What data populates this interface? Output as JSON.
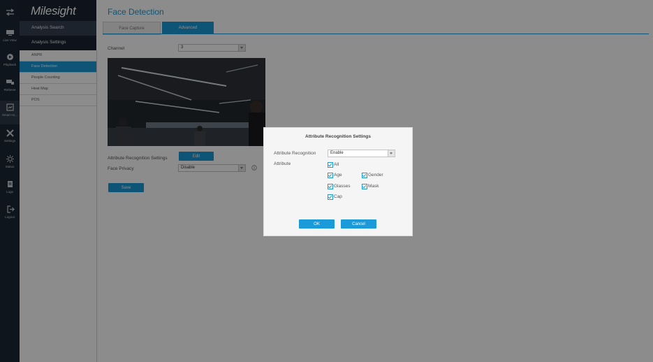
{
  "app": {
    "brand": "Milesight"
  },
  "rail": [
    {
      "label": "",
      "icon": "swap-arrows-icon"
    },
    {
      "label": "Live View",
      "icon": "monitor-icon"
    },
    {
      "label": "Playback",
      "icon": "playback-icon"
    },
    {
      "label": "Retrieve",
      "icon": "retrieve-icon"
    },
    {
      "label": "Smart An...",
      "icon": "smart-analysis-icon"
    },
    {
      "label": "Settings",
      "icon": "tools-icon"
    },
    {
      "label": "Status",
      "icon": "status-icon"
    },
    {
      "label": "Logs",
      "icon": "logs-icon"
    },
    {
      "label": "Logout",
      "icon": "logout-icon"
    }
  ],
  "sidebar": {
    "analysis_search": "Analysis Search",
    "analysis_settings": "Analysis Settings",
    "items": [
      "ANPR",
      "Face Detection",
      "People Counting",
      "Heat Map",
      "POS"
    ]
  },
  "page": {
    "title": "Face Detection",
    "tabs": [
      "Face Capture",
      "Advanced"
    ],
    "channel_label": "Channel",
    "channel_value": "3",
    "attr_label": "Attribute Recognition Settings",
    "edit_label": "Edit",
    "privacy_label": "Face Privacy",
    "privacy_value": "Disable",
    "save_label": "Save"
  },
  "dialog": {
    "title": "Attribute Recognition Settings",
    "recognition_label": "Attribute Recognition",
    "recognition_value": "Enable",
    "attribute_label": "Attribute",
    "checkboxes": [
      "All",
      "Age",
      "Gender",
      "Glasses",
      "Mask",
      "Cap"
    ],
    "ok_label": "OK",
    "cancel_label": "Cancel"
  },
  "colors": {
    "accent": "#1a9ad8",
    "rail": "#1d2733",
    "sidebar": "#1a2230"
  }
}
